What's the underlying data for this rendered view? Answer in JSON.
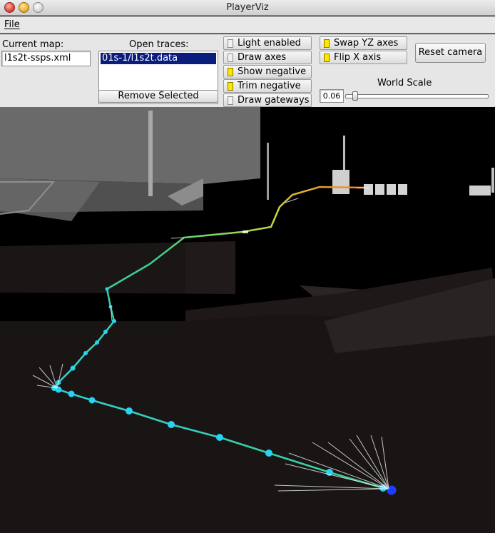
{
  "window": {
    "title": "PlayerViz"
  },
  "menu": {
    "file": "File"
  },
  "map": {
    "label": "Current map:",
    "value": "l1s2t-ssps.xml"
  },
  "traces": {
    "label": "Open traces:",
    "items": [
      "01s-1/l1s2t.data"
    ],
    "remove_button": "Remove Selected"
  },
  "options": {
    "light_enabled": {
      "label": "Light enabled",
      "checked": false
    },
    "draw_axes": {
      "label": "Draw axes",
      "checked": false
    },
    "show_negative": {
      "label": "Show negative",
      "checked": true
    },
    "trim_negative": {
      "label": "Trim negative",
      "checked": true
    },
    "draw_gateways": {
      "label": "Draw gateways",
      "checked": false
    },
    "swap_yz": {
      "label": "Swap YZ axes",
      "checked": true
    },
    "flip_x": {
      "label": "Flip X axis",
      "checked": true
    }
  },
  "camera": {
    "reset_button": "Reset camera"
  },
  "world_scale": {
    "label": "World Scale",
    "value": "0.06"
  },
  "colors": {
    "trace_selected": "#0a1d7c",
    "check_on": "#ffe500",
    "path_start": "#1e3cff",
    "path_cyan": "#27d3f2",
    "path_end": "#ff6a1a"
  }
}
